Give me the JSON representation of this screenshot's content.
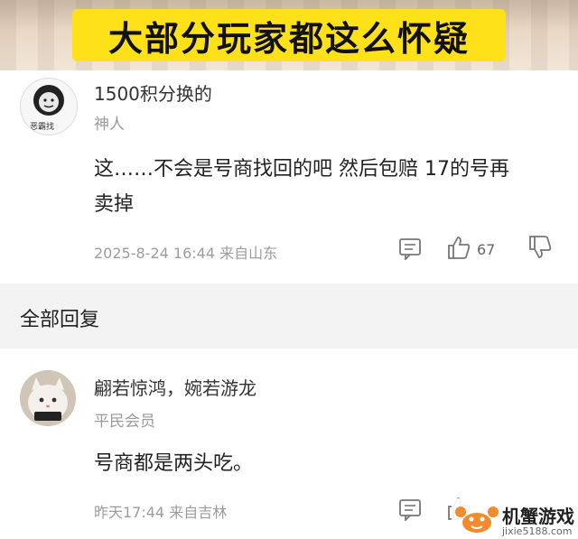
{
  "banner": {
    "title": "大部分玩家都这么怀疑"
  },
  "comment_main": {
    "username": "1500积分换的",
    "role": "神人",
    "text_line1": "这……不会是号商找回的吧 然后包赔 17的号再",
    "text_line2": "卖掉",
    "meta": "2025-8-24 16:44 来自山东",
    "like_count": "67",
    "avatar_label": "恶霸找"
  },
  "section": {
    "title": "全部回复"
  },
  "reply_1": {
    "username": "翩若惊鸿，婉若游龙",
    "role": "平民会员",
    "text": "号商都是两头吃。",
    "meta": "昨天17:44 来自吉林"
  },
  "watermark": {
    "name": "机蟹游戏",
    "domain": "jixie5188.com"
  },
  "colors": {
    "banner_yellow": "#ffe11a",
    "meta_gray": "#9c9c9c",
    "section_bg": "#f3f3f3",
    "logo_orange": "#f28a2e"
  },
  "icons": {
    "comment": "comment-icon",
    "like": "thumbs-up-icon",
    "dislike": "thumbs-down-icon",
    "crab_logo": "crab-logo-icon"
  }
}
